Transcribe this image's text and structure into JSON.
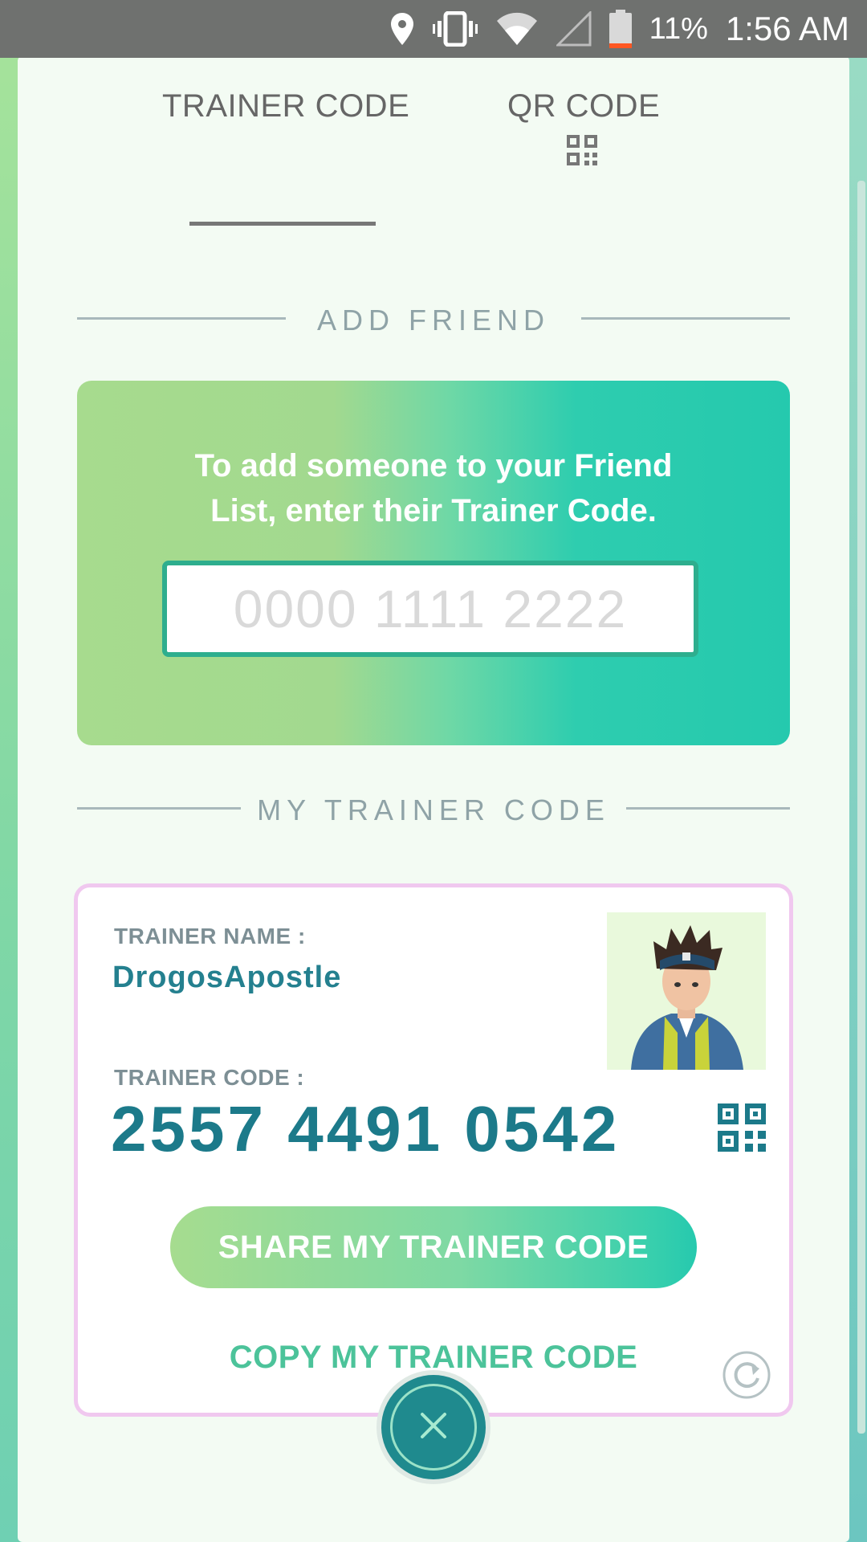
{
  "status_bar": {
    "icons": [
      "location-icon",
      "vibrate-icon",
      "wifi-icon",
      "cell-signal-icon",
      "battery-icon"
    ],
    "battery_percent": "11%",
    "time": "1:56 AM"
  },
  "tabs": [
    {
      "label": "TRAINER CODE",
      "selected": true
    },
    {
      "label": "QR CODE",
      "icon": "qr-code-icon",
      "selected": false
    }
  ],
  "add_friend": {
    "section_title": "ADD FRIEND",
    "message_line1": "To add someone to your Friend",
    "message_line2": "List, enter their Trainer Code.",
    "input_placeholder": "0000 1111 2222",
    "input_value": ""
  },
  "my_trainer_code": {
    "section_title": "MY TRAINER CODE",
    "name_label": "TRAINER NAME :",
    "name_value": "DrogosApostle",
    "code_label": "TRAINER CODE :",
    "code_value": "2557 4491 0542",
    "share_button": "SHARE MY TRAINER CODE",
    "copy_link": "COPY MY TRAINER CODE"
  },
  "colors": {
    "accent_teal": "#1c7a8a",
    "gradient_start": "#a6dc8f",
    "gradient_end": "#26c9ae",
    "card_border": "#f0c8ef"
  }
}
